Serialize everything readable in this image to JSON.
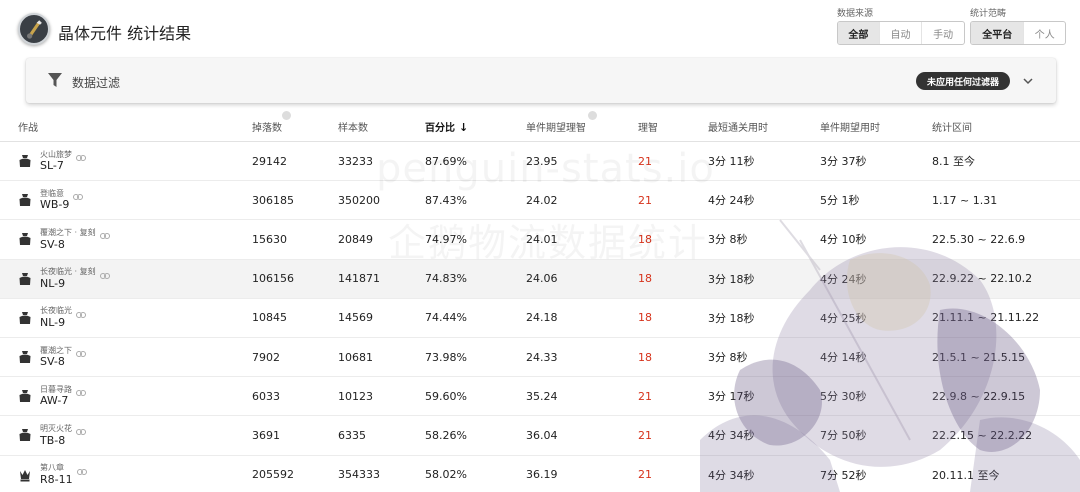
{
  "header": {
    "title": "晶体元件 统计结果",
    "logo_icon": "penguin-logo-icon",
    "source": {
      "label": "数据来源",
      "options": [
        "全部",
        "自动",
        "手动"
      ],
      "selected": "全部"
    },
    "range": {
      "label": "统计范畴",
      "options": [
        "全平台",
        "个人"
      ],
      "selected": "全平台"
    }
  },
  "filter": {
    "title": "数据过滤",
    "icon": "filter-icon",
    "chip": "未应用任何过滤器",
    "chevron": "chevron-down-icon"
  },
  "watermark": {
    "line1": "penguin-stats.io",
    "line2": "企鹅物流数据统计"
  },
  "table": {
    "columns": [
      "作战",
      "掉落数",
      "样本数",
      "百分比",
      "单件期望理智",
      "理智",
      "最短通关用时",
      "单件期望用时",
      "统计区间"
    ],
    "sort_indicator": "↓",
    "rows": [
      {
        "zone": "火山旅梦",
        "code": "SL-7",
        "icon": "crate-icon",
        "drops": "29142",
        "samples": "33233",
        "percent": "87.69%",
        "sanity_per": "23.95",
        "sanity": "21",
        "min_time": "3分 11秒",
        "time_per": "3分 37秒",
        "period": "8.1 至今"
      },
      {
        "zone": "登临意",
        "code": "WB-9",
        "icon": "crate-icon",
        "drops": "306185",
        "samples": "350200",
        "percent": "87.43%",
        "sanity_per": "24.02",
        "sanity": "21",
        "min_time": "4分 24秒",
        "time_per": "5分 1秒",
        "period": "1.17 ~ 1.31"
      },
      {
        "zone": "覆潮之下 · 复刻",
        "code": "SV-8",
        "icon": "crate-icon",
        "drops": "15630",
        "samples": "20849",
        "percent": "74.97%",
        "sanity_per": "24.01",
        "sanity": "18",
        "min_time": "3分 8秒",
        "time_per": "4分 10秒",
        "period": "22.5.30 ~ 22.6.9"
      },
      {
        "zone": "长夜临光 · 复刻",
        "code": "NL-9",
        "icon": "crate-icon",
        "drops": "106156",
        "samples": "141871",
        "percent": "74.83%",
        "sanity_per": "24.06",
        "sanity": "18",
        "min_time": "3分 18秒",
        "time_per": "4分 24秒",
        "period": "22.9.22 ~ 22.10.2"
      },
      {
        "zone": "长夜临光",
        "code": "NL-9",
        "icon": "crate-icon",
        "drops": "10845",
        "samples": "14569",
        "percent": "74.44%",
        "sanity_per": "24.18",
        "sanity": "18",
        "min_time": "3分 18秒",
        "time_per": "4分 25秒",
        "period": "21.11.1 ~ 21.11.22"
      },
      {
        "zone": "覆潮之下",
        "code": "SV-8",
        "icon": "crate-icon",
        "drops": "7902",
        "samples": "10681",
        "percent": "73.98%",
        "sanity_per": "24.33",
        "sanity": "18",
        "min_time": "3分 8秒",
        "time_per": "4分 14秒",
        "period": "21.5.1 ~ 21.5.15"
      },
      {
        "zone": "日暮寻路",
        "code": "AW-7",
        "icon": "crate-icon",
        "drops": "6033",
        "samples": "10123",
        "percent": "59.60%",
        "sanity_per": "35.24",
        "sanity": "21",
        "min_time": "3分 17秒",
        "time_per": "5分 30秒",
        "period": "22.9.8 ~ 22.9.15"
      },
      {
        "zone": "明灭火花",
        "code": "TB-8",
        "icon": "crate-icon",
        "drops": "3691",
        "samples": "6335",
        "percent": "58.26%",
        "sanity_per": "36.04",
        "sanity": "21",
        "min_time": "4分 34秒",
        "time_per": "7分 50秒",
        "period": "22.2.15 ~ 22.2.22"
      },
      {
        "zone": "第八章",
        "code": "R8-11",
        "icon": "chess-king-icon",
        "drops": "205592",
        "samples": "354333",
        "percent": "58.02%",
        "sanity_per": "36.19",
        "sanity": "21",
        "min_time": "4分 34秒",
        "time_per": "7分 52秒",
        "period": "20.11.1 至今"
      }
    ]
  },
  "colors": {
    "sanity_red": "#d6331c",
    "chip_bg": "#333333",
    "active_segment": "#e6e6e6"
  }
}
